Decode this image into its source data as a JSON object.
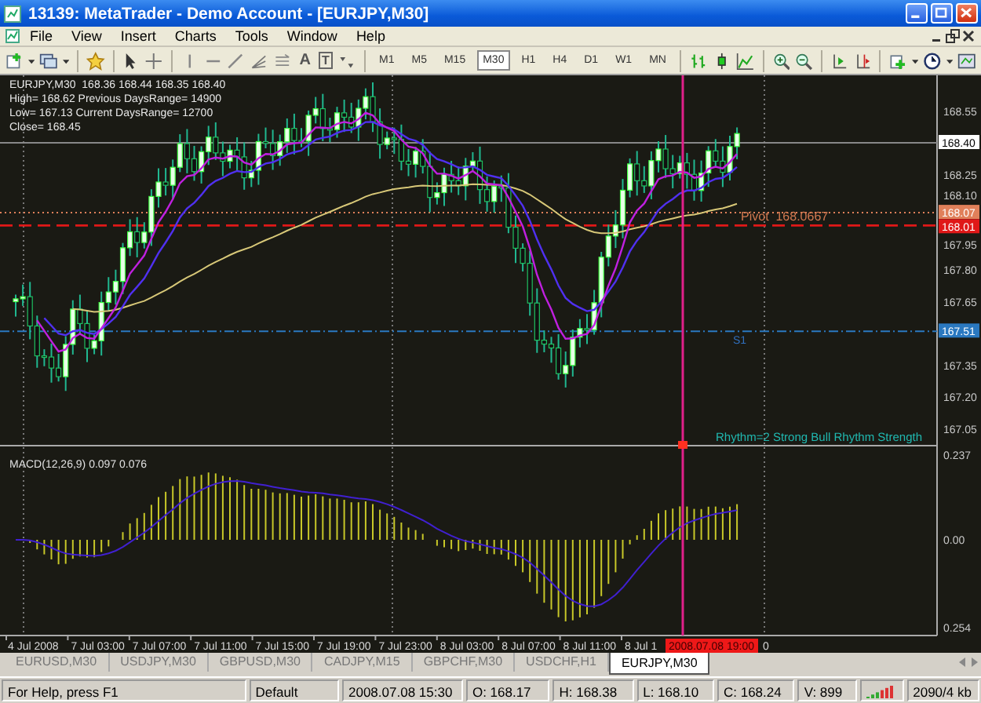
{
  "window": {
    "title": "13139: MetaTrader - Demo Account - [EURJPY,M30]"
  },
  "menu": [
    "File",
    "View",
    "Insert",
    "Charts",
    "Tools",
    "Window",
    "Help"
  ],
  "toolbar": {
    "text_tool": "A",
    "label_tool": "T"
  },
  "timeframes": [
    {
      "label": "M1",
      "selected": false
    },
    {
      "label": "M5",
      "selected": false
    },
    {
      "label": "M15",
      "selected": false
    },
    {
      "label": "M30",
      "selected": true
    },
    {
      "label": "H1",
      "selected": false
    },
    {
      "label": "H4",
      "selected": false
    },
    {
      "label": "D1",
      "selected": false
    },
    {
      "label": "W1",
      "selected": false
    },
    {
      "label": "MN",
      "selected": false
    }
  ],
  "chart": {
    "info": [
      "EURJPY,M30  168.36 168.44 168.35 168.40",
      "High= 168.62 Previous DaysRange= 14900",
      "Low= 167.13 Current DaysRange= 12700",
      "Close= 168.45"
    ],
    "price_axis": [
      "168.55",
      "168.25",
      "168.10",
      "167.95",
      "167.80",
      "167.65",
      "167.35",
      "167.20",
      "167.05"
    ],
    "current_price": "168.40",
    "levels": [
      {
        "value": "168.07",
        "color": "#e0805a"
      },
      {
        "value": "168.01",
        "color": "#e01818"
      },
      {
        "value": "167.51",
        "color": "#2a78c0"
      }
    ],
    "pivot_label": "Pivot  168.0667",
    "s1_label": "S1",
    "rhythm_label": "Rhythm=2 Strong Bull Rhythm Strength"
  },
  "macd": {
    "label": "MACD(12,26,9) 0.097 0.076",
    "axis": [
      "0.237",
      "0.00",
      "0.254"
    ]
  },
  "time_axis": {
    "labels": [
      "4 Jul 2008",
      "7 Jul 03:00",
      "7 Jul 07:00",
      "7 Jul 11:00",
      "7 Jul 15:00",
      "7 Jul 19:00",
      "7 Jul 23:00",
      "8 Jul 03:00",
      "8 Jul 07:00",
      "8 Jul 11:00",
      "8 Jul 1"
    ],
    "cursor_time": "2008.07.08 19:00",
    "tail": "0"
  },
  "tabs": [
    {
      "label": "EURUSD,M30",
      "selected": false
    },
    {
      "label": "USDJPY,M30",
      "selected": false
    },
    {
      "label": "GBPUSD,M30",
      "selected": false
    },
    {
      "label": "CADJPY,M15",
      "selected": false
    },
    {
      "label": "GBPCHF,M30",
      "selected": false
    },
    {
      "label": "USDCHF,H1",
      "selected": false
    },
    {
      "label": "EURJPY,M30",
      "selected": true
    }
  ],
  "status_bar": {
    "help": "For Help, press F1",
    "profile": "Default",
    "time": "2008.07.08 15:30",
    "open": "O: 168.17",
    "high": "H: 168.38",
    "low": "L: 168.10",
    "close": "C: 168.24",
    "volume": "V: 899",
    "traffic": "2090/4 kb"
  }
}
